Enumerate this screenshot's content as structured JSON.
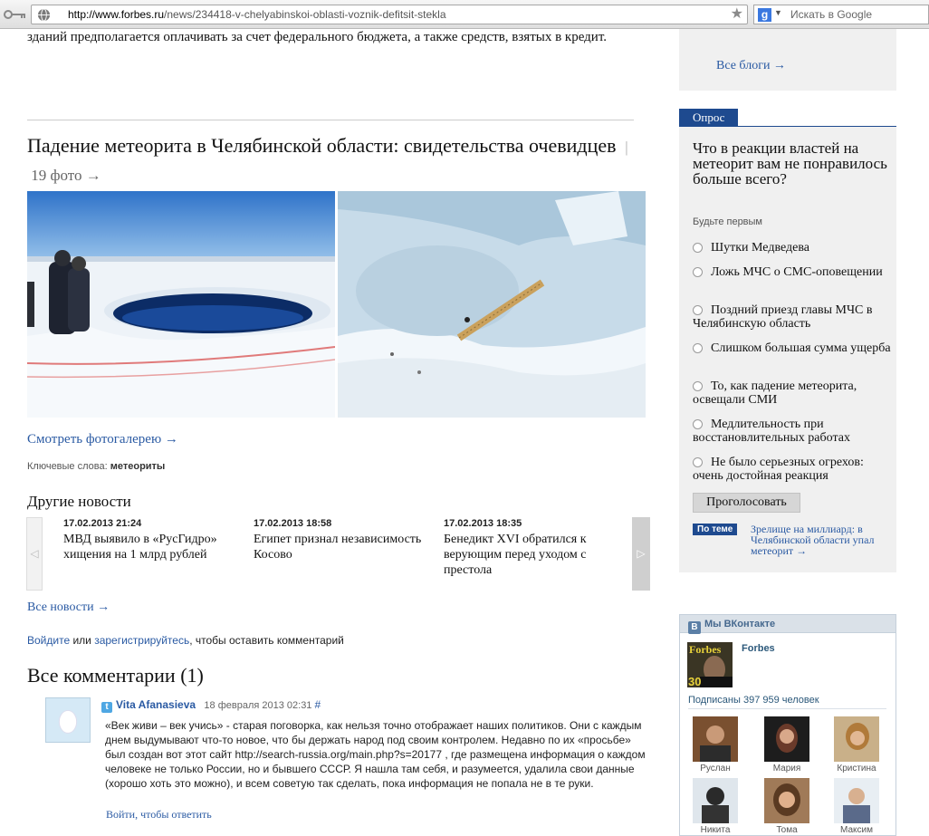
{
  "browser": {
    "url_host": "http://www.forbes.ru",
    "url_path": "/news/234418-v-chelyabinskoi-oblasti-voznik-defitsit-stekla",
    "search_placeholder": "Искать в Google",
    "search_engine_letter": "g"
  },
  "article": {
    "top_text": "зданий предполагается оплачивать за счет федерального бюджета, а также средств, взятых в кредит."
  },
  "gallery": {
    "title": "Падение метеорита в Челябинской области: свидетельства очевидцев",
    "separator": "|",
    "count": "19 фото",
    "count_arrow": "→",
    "link": "Смотреть фотогалерею →"
  },
  "keywords": {
    "label": "Ключевые слова:",
    "value": "метеориты"
  },
  "other_news": {
    "title": "Другие новости",
    "prev_arrow": "◁",
    "next_arrow": "▷",
    "items": [
      {
        "date": "17.02.2013  21:24",
        "headline": "МВД выявило в «РусГидро» хищения на 1 млрд рублей"
      },
      {
        "date": "17.02.2013  18:58",
        "headline": "Египет признал независимость Косово"
      },
      {
        "date": "17.02.2013  18:35",
        "headline": "Бенедикт XVI обратился к верующим перед уходом с престола"
      }
    ],
    "all_link": "Все новости →"
  },
  "login": {
    "login_link": "Войдите",
    "or": " или ",
    "register_link": "зарегистрируйтесь",
    "suffix": ", чтобы оставить комментарий"
  },
  "comments": {
    "title": "Все комментарии (1)",
    "items": [
      {
        "author": "Vita Afanasieva",
        "date": "18 февраля 2013 02:31",
        "hash": "#",
        "body": "«Век живи – век учись» - старая поговорка, как нельзя точно отображает наших политиков. Они с каждым днем выдумывают что-то новое, что бы держать народ под своим контролем. Недавно по их «просьбе» был создан вот этот сайт http://search-russia.org/main.php?s=20177 , где размещена информация о каждом человеке не только России, но и бывшего СССР. Я нашла там себя, и разумеется, удалила свои данные (хорошо хоть это можно), и всем советую так сделать, пока информация не попала не в те руки.",
        "reply": "Войти, чтобы ответить"
      }
    ]
  },
  "sidebar": {
    "blogs_link": "Все блоги →",
    "poll": {
      "tab": "Опрос",
      "question": "Что в реакции властей на метеорит вам не понравилось больше всего?",
      "first_voter": "Будьте первым",
      "options": [
        "Шутки Медведева",
        "Ложь МЧС о СМС-оповещении",
        "Поздний приезд главы МЧС в Челябинскую область",
        "Слишком большая сумма ущерба",
        "То, как падение метеорита, освещали СМИ",
        "Медлительность при восстановлительных работах",
        "Не было серьезных огрехов: очень достойная реакция"
      ],
      "vote_button": "Проголосовать",
      "topic_tag": "По теме",
      "topic_link": "Зрелище на миллиард: в Челябинской области упал метеорит →"
    },
    "vk": {
      "logo_letter": "В",
      "header": "Мы ВКонтакте",
      "group_name": "Forbes",
      "cover_logo": "Forbes",
      "cover_number": "30",
      "subscribers": "Подписаны 397 959 человек",
      "members": [
        "Руслан",
        "Мария",
        "Кристина",
        "Никита",
        "Тома",
        "Максим"
      ]
    }
  }
}
